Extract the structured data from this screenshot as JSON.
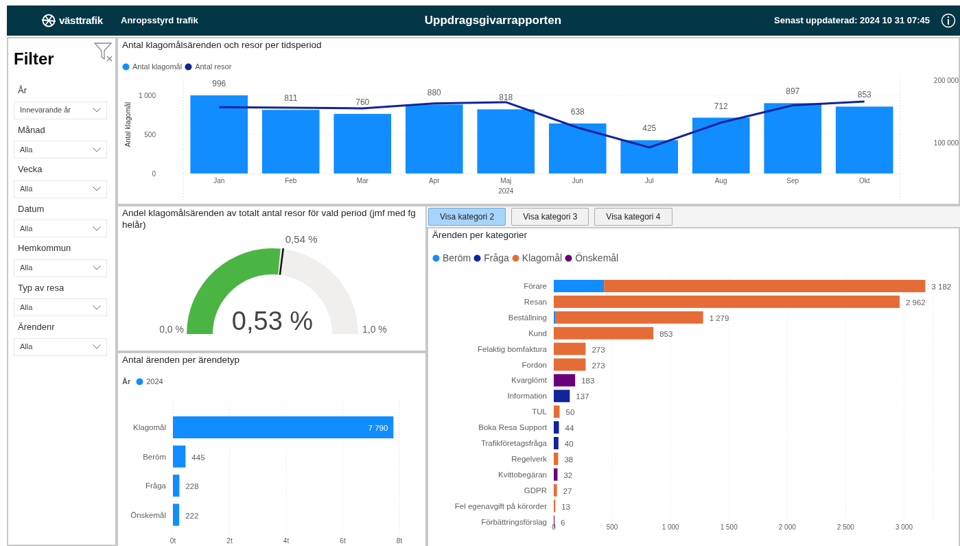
{
  "header": {
    "brand": "västtrafik",
    "subtitle": "Anropsstyrd trafik",
    "title": "Uppdragsgivarrapporten",
    "updated": "Senast uppdaterad: 2024 10 31 07:45"
  },
  "filter": {
    "title": "Filter",
    "fields": [
      {
        "label": "År",
        "value": "Innevarande år"
      },
      {
        "label": "Månad",
        "value": "Alla"
      },
      {
        "label": "Vecka",
        "value": "Alla"
      },
      {
        "label": "Datum",
        "value": "Alla"
      },
      {
        "label": "Hemkommun",
        "value": "Alla"
      },
      {
        "label": "Typ av resa",
        "value": "Alla"
      },
      {
        "label": "Ärendenr",
        "value": "Alla"
      }
    ]
  },
  "trend_panel": {
    "title": "Antal klagomålsärenden och resor per tidsperiod",
    "chart_data": {
      "type": "bar",
      "xlabel": "2024",
      "ylabel": "Antal klagomål",
      "categories": [
        "Jan",
        "Feb",
        "Mar",
        "Apr",
        "Maj",
        "Jun",
        "Jul",
        "Aug",
        "Sep",
        "Okt"
      ],
      "series": [
        {
          "name": "Antal klagomål",
          "color": "#118dff",
          "values": [
            996,
            811,
            760,
            880,
            818,
            638,
            425,
            712,
            897,
            853
          ]
        }
      ],
      "value_labels": [
        "996",
        "811",
        "760",
        "880",
        "818",
        "638",
        "425",
        "712",
        "897",
        "853"
      ],
      "ylim": [
        0,
        1250
      ],
      "yticks": [
        0,
        {
          "value": 500,
          "label": "500"
        },
        {
          "value": 1000,
          "label": "1 000"
        }
      ],
      "grid": true
    },
    "line_overlay": {
      "chart_data": {
        "type": "line",
        "series": [
          {
            "name": "Antal resor",
            "color": "#12239e",
            "values": [
              157000,
              156000,
              155000,
              163000,
              165000,
              124000,
              92000,
              132000,
              160000,
              166000
            ]
          }
        ],
        "ylim": [
          50000,
          208000
        ],
        "yticks": [
          {
            "value": 100000,
            "label": "100 000"
          },
          {
            "value": 200000,
            "label": "200 000"
          }
        ]
      }
    }
  },
  "gauge_panel": {
    "title": "Andel klagomålsärenden av totalt antal resor för vald period (jmf med fg helår)",
    "value": "0,53 %",
    "level": 0.53,
    "min": "0,0 %",
    "max": "1,0 %",
    "target": {
      "label": "0,54 %",
      "level": 0.54
    }
  },
  "type_panel": {
    "title": "Antal ärenden per ärendetyp",
    "legend_title": "År",
    "chart_data": {
      "type": "bar",
      "orientation": "horizontal",
      "categories": [
        "Klagomål",
        "Beröm",
        "Fråga",
        "Önskemål"
      ],
      "series": [
        {
          "name": "2024",
          "color": "#118dff",
          "values": [
            7.79,
            0.445,
            0.228,
            0.222
          ]
        }
      ],
      "value_labels": [
        "7 790",
        "445",
        "228",
        "222"
      ],
      "xlim": [
        0,
        8
      ],
      "xticks": [
        {
          "value": 0,
          "label": "0t"
        },
        {
          "value": 2,
          "label": "2t"
        },
        {
          "value": 4,
          "label": "4t"
        },
        {
          "value": 6,
          "label": "6t"
        },
        {
          "value": 8,
          "label": "8t"
        }
      ],
      "grid": true
    }
  },
  "tabs": [
    {
      "label": "Visa kategori 2",
      "selected": true
    },
    {
      "label": "Visa kategori 3",
      "selected": false
    },
    {
      "label": "Visa kategori 4",
      "selected": false
    }
  ],
  "category_panel": {
    "title": "Ärenden per kategorier",
    "chart_data": {
      "type": "bar",
      "orientation": "horizontal",
      "stacked": true,
      "categories": [
        "Förare",
        "Resan",
        "Beställning",
        "Kund",
        "Felaktig bomfaktura",
        "Fordon",
        "Kvarglömt",
        "Information",
        "TUL",
        "Boka Resa Support",
        "Trafikföretagsfråga",
        "Regelverk",
        "Kvittobegäran",
        "GDPR",
        "Fel egenavgift på körorder",
        "Förbättringsförslag"
      ],
      "series": [
        {
          "name": "Beröm",
          "color": "#118dff",
          "values": [
            430,
            null,
            12,
            null,
            null,
            null,
            null,
            null,
            null,
            null,
            null,
            null,
            null,
            null,
            null,
            null
          ]
        },
        {
          "name": "Fråga",
          "color": "#12239e",
          "values": [
            null,
            null,
            null,
            null,
            null,
            null,
            null,
            137,
            null,
            44,
            40,
            null,
            null,
            null,
            null,
            null
          ]
        },
        {
          "name": "Klagomål",
          "color": "#e66c37",
          "values": [
            2752,
            2962,
            1267,
            853,
            273,
            273,
            null,
            null,
            50,
            null,
            null,
            38,
            null,
            27,
            13,
            null
          ]
        },
        {
          "name": "Önskemål",
          "color": "#6b007b",
          "values": [
            null,
            null,
            null,
            null,
            null,
            null,
            183,
            null,
            null,
            null,
            null,
            null,
            32,
            null,
            null,
            6
          ]
        }
      ],
      "value_labels": [
        "3 182",
        "2 962",
        "1 279",
        "853",
        "273",
        "273",
        "183",
        "137",
        "50",
        "44",
        "40",
        "38",
        "32",
        "27",
        "13",
        "6"
      ],
      "xlim": [
        0,
        3250
      ],
      "xticks": [
        {
          "value": 0,
          "label": "0"
        },
        {
          "value": 500,
          "label": "500"
        },
        {
          "value": 1000,
          "label": "1 000"
        },
        {
          "value": 1500,
          "label": "1 500"
        },
        {
          "value": 2000,
          "label": "2 000"
        },
        {
          "value": 2500,
          "label": "2 500"
        },
        {
          "value": 3000,
          "label": "3 000"
        }
      ],
      "grid": true
    }
  }
}
